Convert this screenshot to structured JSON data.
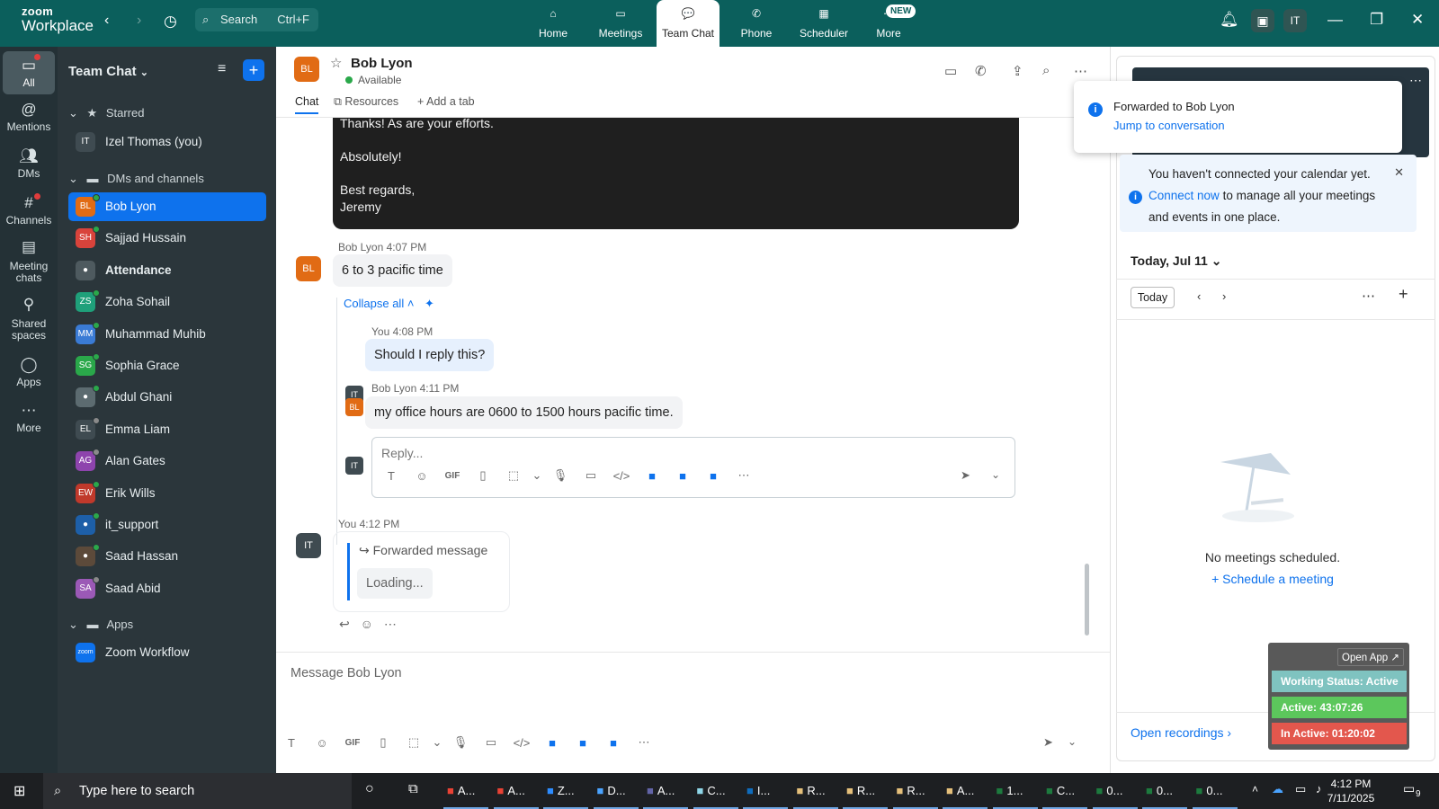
{
  "topbar": {
    "brand_line1": "zoom",
    "brand_line2": "Workplace",
    "search_label": "Search",
    "search_shortcut": "Ctrl+F",
    "tabs": [
      {
        "label": "Home",
        "icon": "home-icon"
      },
      {
        "label": "Meetings",
        "icon": "video-camera-icon"
      },
      {
        "label": "Team Chat",
        "icon": "chat-icon",
        "active": true
      },
      {
        "label": "Phone",
        "icon": "phone-icon"
      },
      {
        "label": "Scheduler",
        "icon": "calendar-icon"
      },
      {
        "label": "More",
        "icon": "more-icon"
      }
    ],
    "new_badge": "NEW",
    "user_initials": "IT"
  },
  "rail": {
    "items": [
      {
        "label": "All",
        "icon": "chat-bubble-icon"
      },
      {
        "label": "Mentions",
        "icon": "at-icon"
      },
      {
        "label": "DMs",
        "icon": "people-icon"
      },
      {
        "label": "Channels",
        "icon": "hash-icon"
      },
      {
        "label": "Meeting chats",
        "icon": "meeting-chat-icon"
      },
      {
        "label": "Shared spaces",
        "icon": "shared-spaces-icon"
      },
      {
        "label": "Apps",
        "icon": "apps-icon"
      },
      {
        "label": "More",
        "icon": "more-icon"
      }
    ]
  },
  "sidebar": {
    "title": "Team Chat",
    "starred_label": "Starred",
    "starred": [
      {
        "initials": "IT",
        "name": "Izel Thomas (you)",
        "color": "#3f4b51"
      }
    ],
    "dms_label": "DMs and channels",
    "dms": [
      {
        "initials": "BL",
        "name": "Bob Lyon",
        "color": "#e16b14",
        "status": "#2aa84a"
      },
      {
        "initials": "SH",
        "name": "Sajjad Hussain",
        "color": "#d9433b",
        "status": "#2aa84a"
      },
      {
        "initials": "",
        "name": "Attendance",
        "color": "#4e5a5f",
        "status": ""
      },
      {
        "initials": "ZS",
        "name": "Zoha Sohail",
        "color": "#1fa07a",
        "status": "#2aa84a"
      },
      {
        "initials": "MM",
        "name": "Muhammad Muhib",
        "color": "#3a7bd5",
        "status": "#2aa84a"
      },
      {
        "initials": "SG",
        "name": "Sophia Grace",
        "color": "#2aa84a",
        "status": "#2aa84a"
      },
      {
        "initials": "",
        "name": "Abdul Ghani",
        "color": "#5c6b70",
        "status": "#2aa84a"
      },
      {
        "initials": "EL",
        "name": "Emma Liam",
        "color": "#3f4b51",
        "status": "#8a8a8a"
      },
      {
        "initials": "AG",
        "name": "Alan Gates",
        "color": "#8e44ad",
        "status": "#8a8a8a"
      },
      {
        "initials": "EW",
        "name": "Erik Wills",
        "color": "#c0392b",
        "status": "#2aa84a"
      },
      {
        "initials": "",
        "name": "it_support",
        "color": "#1d5fa8",
        "status": "#2aa84a"
      },
      {
        "initials": "",
        "name": "Saad Hassan",
        "color": "#5c4a3a",
        "status": "#2aa84a"
      },
      {
        "initials": "SA",
        "name": "Saad Abid",
        "color": "#9b59b6",
        "status": "#8a8a8a"
      }
    ],
    "apps_label": "Apps",
    "apps": [
      {
        "initials": "zoom",
        "name": "Zoom Workflow",
        "color": "#0e72ed"
      }
    ]
  },
  "chat": {
    "contact_initials": "BL",
    "contact_name": "Bob Lyon",
    "contact_status": "Available",
    "tabs": [
      "Chat",
      "Resources",
      "Add a tab"
    ],
    "dark_message_lines": [
      "Thanks! As are your efforts.",
      "Absolutely!",
      "Best regards,",
      "Jeremy"
    ],
    "msg1_meta": "Bob Lyon 4:07 PM",
    "msg1_text": "6 to 3 pacific time",
    "collapse_label": "Collapse all",
    "reply1_meta": "You 4:08 PM",
    "reply1_text": "Should I reply this?",
    "reply2_meta": "Bob Lyon 4:11 PM",
    "reply2_text": "my office hours are 0600 to 1500 hours pacific time.",
    "reply_placeholder": "Reply...",
    "msg2_meta": "You 4:12 PM",
    "forwarded_label": "Forwarded message",
    "loading_label": "Loading...",
    "compose_placeholder": "Message Bob Lyon",
    "toolbar_gif": "GIF",
    "my_initials": "IT"
  },
  "right": {
    "toast_title": "Forwarded to Bob Lyon",
    "toast_link": "Jump to conversation",
    "cal_note_pre": "You haven't connected your calendar yet.",
    "cal_note_link": "Connect now",
    "cal_note_post": "to manage all your meetings and events in one place.",
    "today_header": "Today, Jul 11",
    "today_button": "Today",
    "no_meetings": "No meetings scheduled.",
    "schedule_link": "Schedule a meeting",
    "open_recordings": "Open recordings",
    "widget": {
      "open_app": "Open App ↗",
      "status": "Working Status: Active",
      "active": "Active: 43:07:26",
      "inactive": "In Active: 01:20:02"
    }
  },
  "taskbar": {
    "search_placeholder": "Type here to search",
    "apps": [
      "A...",
      "A...",
      "Z...",
      "D...",
      "A...",
      "C...",
      "I...",
      "R...",
      "R...",
      "R...",
      "A...",
      "1...",
      "C...",
      "0...",
      "0...",
      "0..."
    ],
    "time": "4:12 PM",
    "date": "7/11/2025",
    "notifications": "9"
  }
}
